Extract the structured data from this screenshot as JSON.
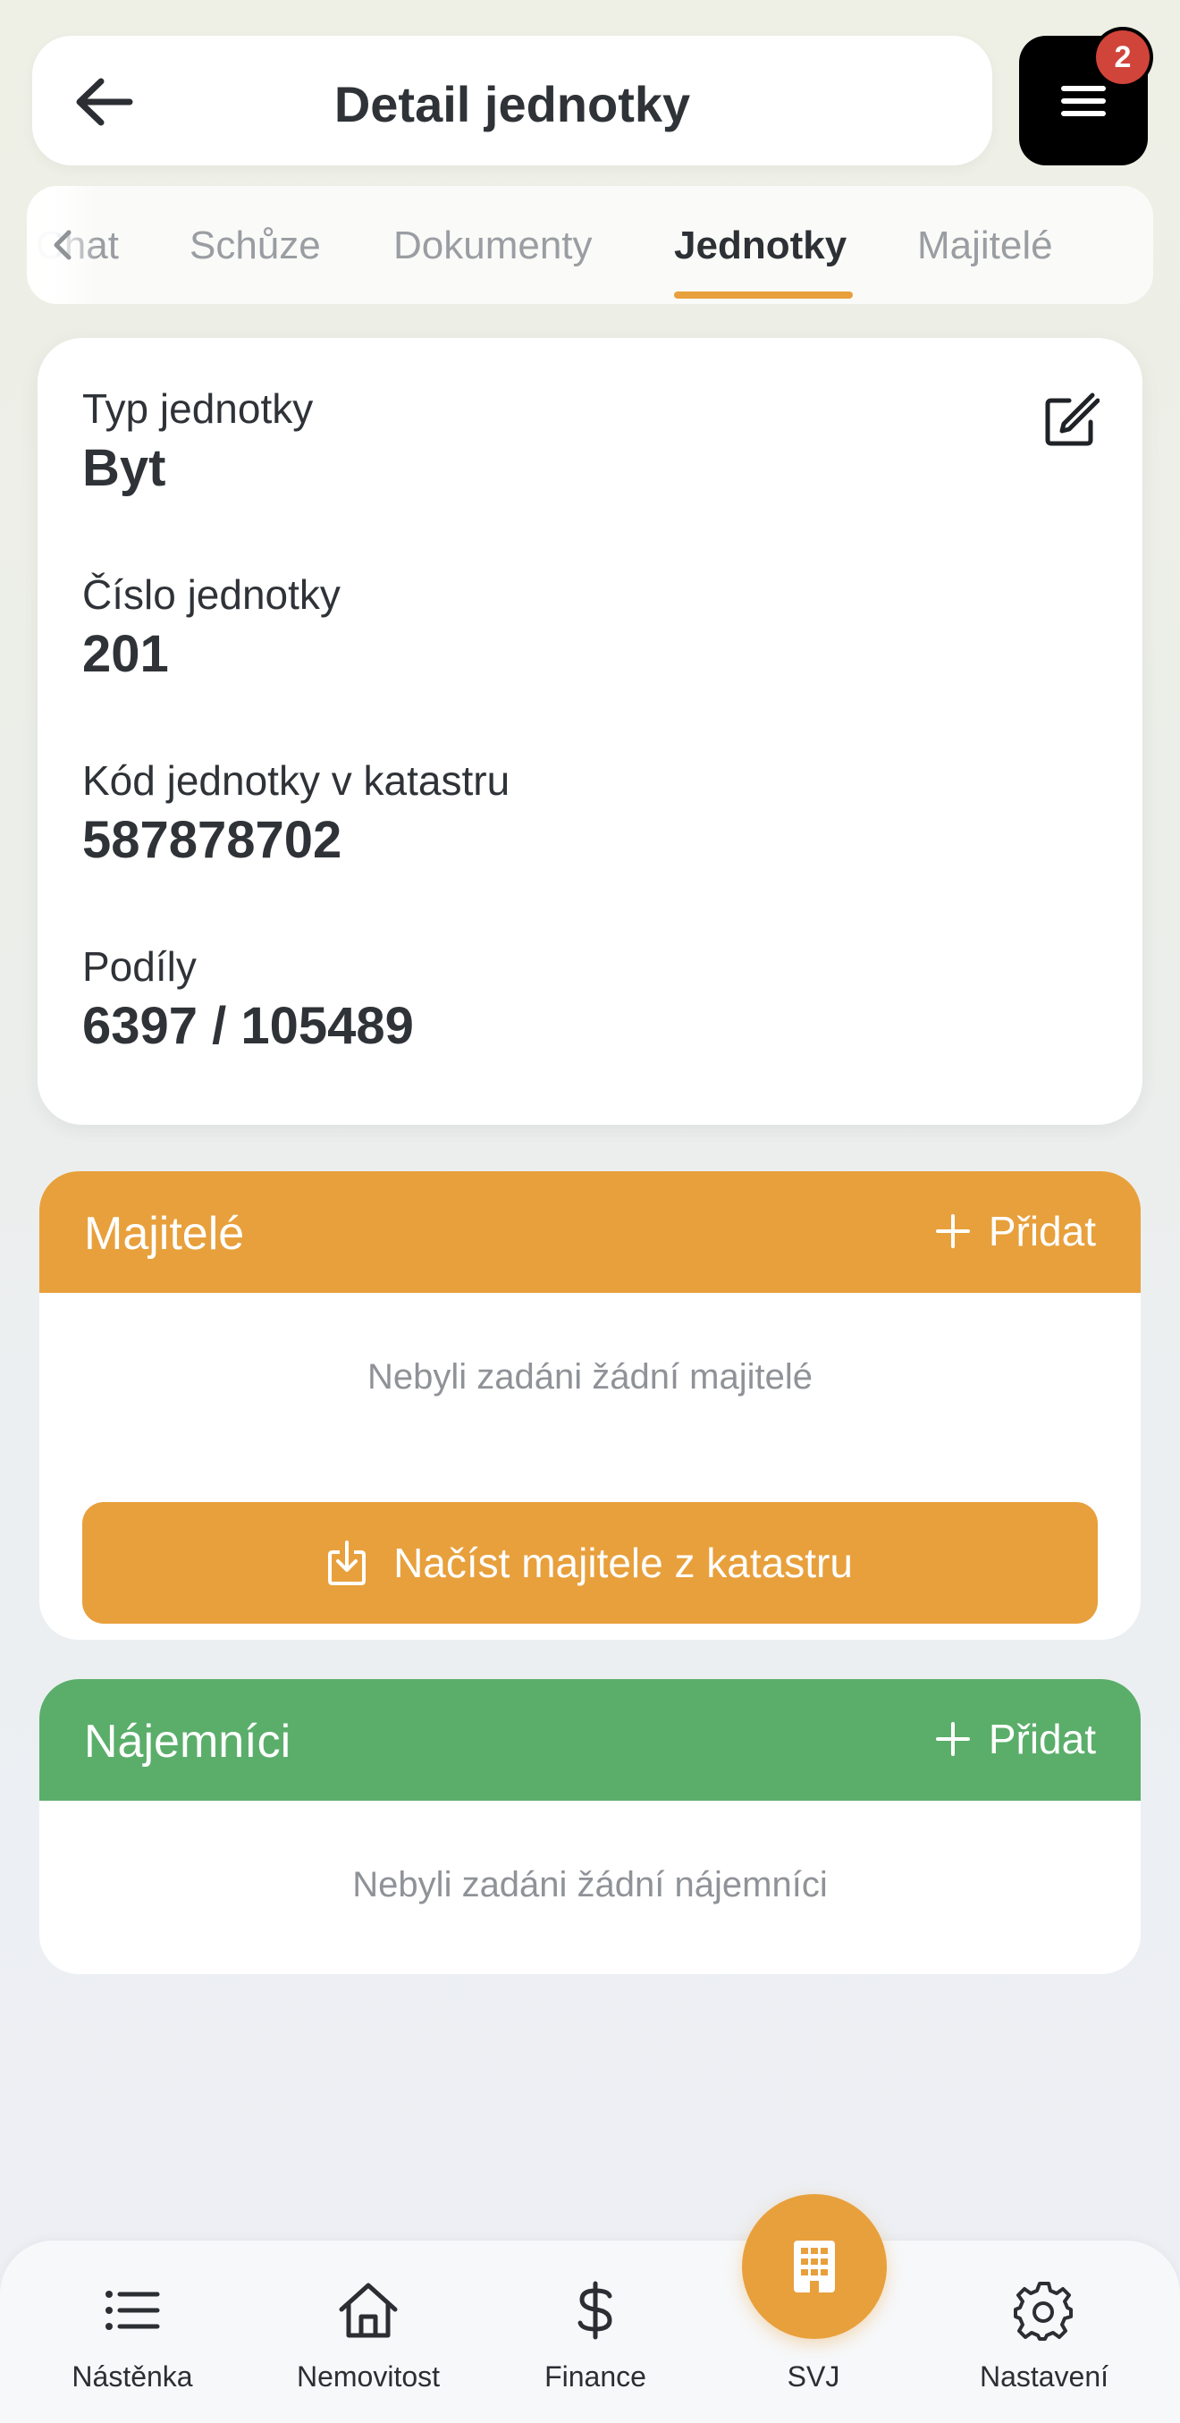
{
  "header": {
    "title": "Detail jednotky",
    "notification_count": "2"
  },
  "tabs": [
    {
      "label": "Chat",
      "active": false
    },
    {
      "label": "Schůze",
      "active": false
    },
    {
      "label": "Dokumenty",
      "active": false
    },
    {
      "label": "Jednotky",
      "active": true
    },
    {
      "label": "Majitelé",
      "active": false
    }
  ],
  "unit": {
    "type_label": "Typ jednotky",
    "type_value": "Byt",
    "number_label": "Číslo jednotky",
    "number_value": "201",
    "cadastre_code_label": "Kód jednotky v katastru",
    "cadastre_code_value": "587878702",
    "shares_label": "Podíly",
    "shares_value": "6397 / 105489"
  },
  "owners": {
    "title": "Majitelé",
    "add_label": "Přidat",
    "empty_text": "Nebyli zadáni žádní majitelé",
    "load_button_label": "Načíst majitele z katastru",
    "color": "#e8a03c"
  },
  "tenants": {
    "title": "Nájemníci",
    "add_label": "Přidat",
    "empty_text": "Nebyli zadáni žádní nájemníci",
    "color": "#5aae6a"
  },
  "bottom_nav": [
    {
      "label": "Nástěnka",
      "icon": "list-icon"
    },
    {
      "label": "Nemovitost",
      "icon": "home-icon"
    },
    {
      "label": "Finance",
      "icon": "dollar-icon"
    },
    {
      "label": "SVJ",
      "icon": "building-icon",
      "active": true
    },
    {
      "label": "Nastavení",
      "icon": "gear-icon"
    }
  ],
  "colors": {
    "accent": "#e8a03c",
    "green": "#5aae6a",
    "badge": "#d1443a"
  }
}
